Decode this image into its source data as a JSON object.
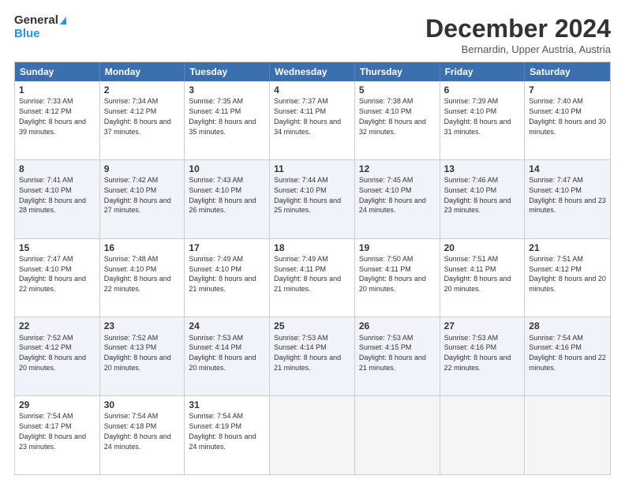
{
  "logo": {
    "line1": "General",
    "line2": "Blue"
  },
  "title": "December 2024",
  "location": "Bernardin, Upper Austria, Austria",
  "days_of_week": [
    "Sunday",
    "Monday",
    "Tuesday",
    "Wednesday",
    "Thursday",
    "Friday",
    "Saturday"
  ],
  "weeks": [
    [
      {
        "day": "1",
        "sunrise": "7:33 AM",
        "sunset": "4:12 PM",
        "daylight": "8 hours and 39 minutes."
      },
      {
        "day": "2",
        "sunrise": "7:34 AM",
        "sunset": "4:12 PM",
        "daylight": "8 hours and 37 minutes."
      },
      {
        "day": "3",
        "sunrise": "7:35 AM",
        "sunset": "4:11 PM",
        "daylight": "8 hours and 35 minutes."
      },
      {
        "day": "4",
        "sunrise": "7:37 AM",
        "sunset": "4:11 PM",
        "daylight": "8 hours and 34 minutes."
      },
      {
        "day": "5",
        "sunrise": "7:38 AM",
        "sunset": "4:10 PM",
        "daylight": "8 hours and 32 minutes."
      },
      {
        "day": "6",
        "sunrise": "7:39 AM",
        "sunset": "4:10 PM",
        "daylight": "8 hours and 31 minutes."
      },
      {
        "day": "7",
        "sunrise": "7:40 AM",
        "sunset": "4:10 PM",
        "daylight": "8 hours and 30 minutes."
      }
    ],
    [
      {
        "day": "8",
        "sunrise": "7:41 AM",
        "sunset": "4:10 PM",
        "daylight": "8 hours and 28 minutes."
      },
      {
        "day": "9",
        "sunrise": "7:42 AM",
        "sunset": "4:10 PM",
        "daylight": "8 hours and 27 minutes."
      },
      {
        "day": "10",
        "sunrise": "7:43 AM",
        "sunset": "4:10 PM",
        "daylight": "8 hours and 26 minutes."
      },
      {
        "day": "11",
        "sunrise": "7:44 AM",
        "sunset": "4:10 PM",
        "daylight": "8 hours and 25 minutes."
      },
      {
        "day": "12",
        "sunrise": "7:45 AM",
        "sunset": "4:10 PM",
        "daylight": "8 hours and 24 minutes."
      },
      {
        "day": "13",
        "sunrise": "7:46 AM",
        "sunset": "4:10 PM",
        "daylight": "8 hours and 23 minutes."
      },
      {
        "day": "14",
        "sunrise": "7:47 AM",
        "sunset": "4:10 PM",
        "daylight": "8 hours and 23 minutes."
      }
    ],
    [
      {
        "day": "15",
        "sunrise": "7:47 AM",
        "sunset": "4:10 PM",
        "daylight": "8 hours and 22 minutes."
      },
      {
        "day": "16",
        "sunrise": "7:48 AM",
        "sunset": "4:10 PM",
        "daylight": "8 hours and 22 minutes."
      },
      {
        "day": "17",
        "sunrise": "7:49 AM",
        "sunset": "4:10 PM",
        "daylight": "8 hours and 21 minutes."
      },
      {
        "day": "18",
        "sunrise": "7:49 AM",
        "sunset": "4:11 PM",
        "daylight": "8 hours and 21 minutes."
      },
      {
        "day": "19",
        "sunrise": "7:50 AM",
        "sunset": "4:11 PM",
        "daylight": "8 hours and 20 minutes."
      },
      {
        "day": "20",
        "sunrise": "7:51 AM",
        "sunset": "4:11 PM",
        "daylight": "8 hours and 20 minutes."
      },
      {
        "day": "21",
        "sunrise": "7:51 AM",
        "sunset": "4:12 PM",
        "daylight": "8 hours and 20 minutes."
      }
    ],
    [
      {
        "day": "22",
        "sunrise": "7:52 AM",
        "sunset": "4:12 PM",
        "daylight": "8 hours and 20 minutes."
      },
      {
        "day": "23",
        "sunrise": "7:52 AM",
        "sunset": "4:13 PM",
        "daylight": "8 hours and 20 minutes."
      },
      {
        "day": "24",
        "sunrise": "7:53 AM",
        "sunset": "4:14 PM",
        "daylight": "8 hours and 20 minutes."
      },
      {
        "day": "25",
        "sunrise": "7:53 AM",
        "sunset": "4:14 PM",
        "daylight": "8 hours and 21 minutes."
      },
      {
        "day": "26",
        "sunrise": "7:53 AM",
        "sunset": "4:15 PM",
        "daylight": "8 hours and 21 minutes."
      },
      {
        "day": "27",
        "sunrise": "7:53 AM",
        "sunset": "4:16 PM",
        "daylight": "8 hours and 22 minutes."
      },
      {
        "day": "28",
        "sunrise": "7:54 AM",
        "sunset": "4:16 PM",
        "daylight": "8 hours and 22 minutes."
      }
    ],
    [
      {
        "day": "29",
        "sunrise": "7:54 AM",
        "sunset": "4:17 PM",
        "daylight": "8 hours and 23 minutes."
      },
      {
        "day": "30",
        "sunrise": "7:54 AM",
        "sunset": "4:18 PM",
        "daylight": "8 hours and 24 minutes."
      },
      {
        "day": "31",
        "sunrise": "7:54 AM",
        "sunset": "4:19 PM",
        "daylight": "8 hours and 24 minutes."
      },
      null,
      null,
      null,
      null
    ]
  ],
  "alt_rows": [
    1,
    3
  ],
  "labels": {
    "sunrise": "Sunrise:",
    "sunset": "Sunset:",
    "daylight": "Daylight:"
  }
}
